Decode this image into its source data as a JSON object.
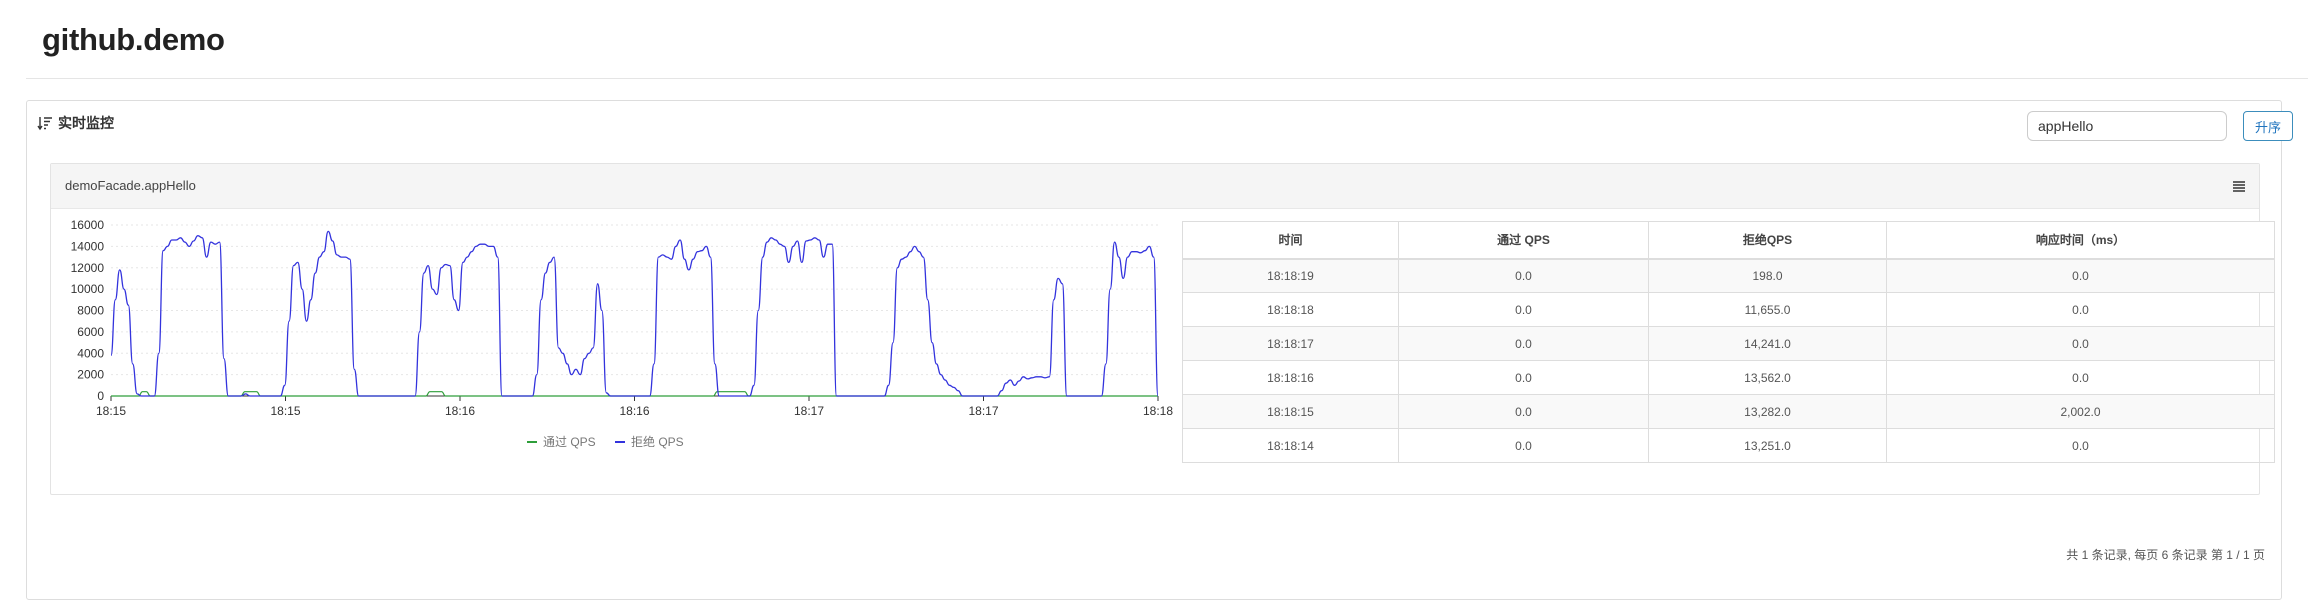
{
  "header": {
    "title": "github.demo"
  },
  "panel": {
    "heading": "实时监控",
    "search": {
      "value": "appHello",
      "placeholder": ""
    },
    "sort_button_label": "升序"
  },
  "card": {
    "title": "demoFacade.appHello",
    "menu_icon": "menu-icon"
  },
  "table": {
    "columns": [
      "时间",
      "通过 QPS",
      "拒绝QPS",
      "响应时间（ms）"
    ],
    "rows": [
      [
        "18:18:19",
        "0.0",
        "198.0",
        "0.0"
      ],
      [
        "18:18:18",
        "0.0",
        "11,655.0",
        "0.0"
      ],
      [
        "18:18:17",
        "0.0",
        "14,241.0",
        "0.0"
      ],
      [
        "18:18:16",
        "0.0",
        "13,562.0",
        "0.0"
      ],
      [
        "18:18:15",
        "0.0",
        "13,282.0",
        "2,002.0"
      ],
      [
        "18:18:14",
        "0.0",
        "13,251.0",
        "0.0"
      ]
    ]
  },
  "pagination": {
    "text": "共 1 条记录, 每页 6 条记录 第 1 / 1 页"
  },
  "colors": {
    "pass": "#2e9e3a",
    "block": "#3333dd",
    "accent": "#1e73be"
  },
  "chart_data": {
    "type": "line",
    "title": "",
    "xlabel": "",
    "ylabel": "",
    "ylim": [
      0,
      16000
    ],
    "yticks": [
      0,
      2000,
      4000,
      6000,
      8000,
      10000,
      12000,
      14000,
      16000
    ],
    "xtick_labels": [
      "18:15",
      "18:15",
      "18:16",
      "18:16",
      "18:17",
      "18:17",
      "18:18"
    ],
    "grid": true,
    "legend": "bottom",
    "series": [
      {
        "name": "通过 QPS",
        "color": "#2e9e3a",
        "values": [
          0,
          0,
          0,
          0,
          0,
          0,
          0,
          0,
          400,
          400,
          0,
          0,
          0,
          0,
          0,
          0,
          0,
          0,
          0,
          0,
          0,
          0,
          0,
          0,
          0,
          0,
          0,
          0,
          0,
          0,
          0,
          0,
          0,
          0,
          400,
          400,
          400,
          400,
          0,
          0,
          0,
          0,
          0,
          0,
          0,
          0,
          0,
          0,
          0,
          0,
          0,
          0,
          0,
          0,
          0,
          0,
          0,
          0,
          0,
          0,
          0,
          0,
          0,
          0,
          0,
          0,
          0,
          0,
          0,
          0,
          0,
          0,
          0,
          0,
          0,
          0,
          0,
          0,
          0,
          0,
          0,
          400,
          400,
          400,
          400,
          0,
          0,
          0,
          0,
          0,
          0,
          0,
          0,
          0,
          0,
          0,
          0,
          0,
          0,
          0,
          0,
          0,
          0,
          0,
          0,
          0,
          0,
          0,
          0,
          0,
          0,
          0,
          0,
          0,
          0,
          0,
          0,
          0,
          0,
          0,
          0,
          0,
          0,
          0,
          0,
          0,
          0,
          0,
          0,
          0,
          0,
          0,
          0,
          0,
          0,
          0,
          0,
          0,
          0,
          0,
          0,
          0,
          0,
          0,
          0,
          0,
          0,
          0,
          0,
          0,
          0,
          0,
          0,
          0,
          400,
          400,
          400,
          400,
          400,
          400,
          400,
          400,
          0,
          0,
          0,
          0,
          0,
          0,
          0,
          0,
          0,
          0,
          0,
          0,
          0,
          0,
          0,
          0,
          0,
          0,
          0,
          0,
          0,
          0,
          0,
          0,
          0,
          0,
          0,
          0,
          0,
          0,
          0,
          0,
          0,
          0,
          0,
          0,
          0,
          0,
          0,
          0,
          0,
          0,
          0,
          0,
          0,
          0,
          0,
          0,
          0,
          0,
          0,
          0,
          0,
          0,
          0,
          0,
          0,
          0,
          0,
          0,
          0,
          0,
          0,
          0,
          0,
          0,
          0,
          0,
          0,
          0,
          0,
          0,
          0,
          0,
          0,
          0,
          0,
          0,
          0,
          0,
          0,
          0,
          0,
          0,
          0,
          0,
          0,
          0,
          0,
          0,
          0,
          0,
          0,
          0,
          0,
          0,
          0,
          0,
          0,
          0,
          0,
          0,
          0,
          0,
          0
        ]
      },
      {
        "name": "拒绝 QPS",
        "color": "#3333dd",
        "values": [
          3800,
          9000,
          11800,
          10000,
          8500,
          3000,
          200,
          0,
          0,
          0,
          0,
          4000,
          13600,
          14000,
          14600,
          14600,
          14800,
          14400,
          14000,
          14500,
          15000,
          14800,
          13000,
          14400,
          14200,
          14400,
          3500,
          0,
          0,
          0,
          0,
          200,
          0,
          0,
          0,
          0,
          0,
          0,
          0,
          0,
          1000,
          7000,
          12200,
          12500,
          10000,
          7000,
          9000,
          11500,
          13000,
          13500,
          15400,
          14500,
          13200,
          13000,
          13000,
          12800,
          2500,
          0,
          0,
          0,
          0,
          0,
          0,
          0,
          0,
          0,
          0,
          0,
          0,
          0,
          0,
          6000,
          11500,
          12200,
          10000,
          9500,
          12000,
          12300,
          12200,
          9000,
          8000,
          12500,
          13000,
          13500,
          14000,
          14200,
          14200,
          14000,
          14000,
          13000,
          0,
          0,
          0,
          0,
          0,
          0,
          0,
          0,
          2000,
          9000,
          11500,
          12500,
          13000,
          4500,
          4000,
          3000,
          2000,
          2500,
          2000,
          3500,
          4000,
          4500,
          10500,
          8000,
          300,
          0,
          0,
          0,
          0,
          0,
          0,
          0,
          0,
          0,
          0,
          3000,
          13000,
          13200,
          13000,
          12800,
          14000,
          14600,
          12800,
          11800,
          12800,
          13500,
          13600,
          14000,
          13000,
          3000,
          0,
          0,
          0,
          0,
          0,
          0,
          0,
          0,
          1000,
          8000,
          13000,
          14400,
          14800,
          14600,
          14200,
          14000,
          12500,
          14000,
          14500,
          12500,
          14500,
          14600,
          14800,
          14600,
          13000,
          14200,
          14200,
          0,
          0,
          0,
          0,
          0,
          0,
          0,
          0,
          0,
          0,
          0,
          0,
          1000,
          5000,
          12000,
          12800,
          13000,
          13500,
          14000,
          13500,
          13000,
          9000,
          5000,
          3000,
          2000,
          1500,
          1000,
          800,
          500,
          0,
          0,
          0,
          0,
          0,
          0,
          0,
          0,
          0,
          500,
          1200,
          1500,
          1000,
          1400,
          1800,
          1600,
          1700,
          1800,
          1800,
          1700,
          1800,
          9000,
          11000,
          10500,
          0,
          0,
          0,
          0,
          0,
          0,
          0,
          0,
          0,
          3000,
          10000,
          14400,
          13000,
          11000,
          13000,
          13500,
          13500,
          13400,
          13600,
          14000,
          13000,
          0
        ]
      }
    ]
  }
}
